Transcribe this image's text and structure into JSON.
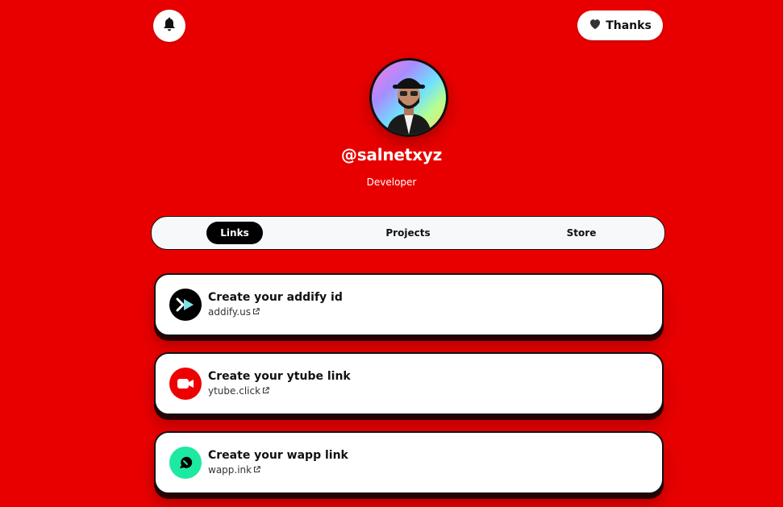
{
  "header": {
    "bell_icon": "bell-icon",
    "thanks_label": "Thanks",
    "thanks_icon": "heart-icon"
  },
  "profile": {
    "handle": "@salnetxyz",
    "bio": "Developer"
  },
  "tabs": [
    {
      "label": "Links",
      "active": true
    },
    {
      "label": "Projects",
      "active": false
    },
    {
      "label": "Store",
      "active": false
    }
  ],
  "links": [
    {
      "title": "Create your addify id",
      "domain": "addify.us",
      "icon": "addify-icon",
      "icon_bg": "#000000"
    },
    {
      "title": "Create your ytube link",
      "domain": "ytube.click",
      "icon": "video-camera-icon",
      "icon_bg": "#ee0000"
    },
    {
      "title": "Create your wapp link",
      "domain": "wapp.ink",
      "icon": "wapp-icon",
      "icon_bg": "#1de9a0"
    }
  ],
  "colors": {
    "background": "#e80000",
    "card": "#ffffff",
    "active_tab": "#000000"
  }
}
